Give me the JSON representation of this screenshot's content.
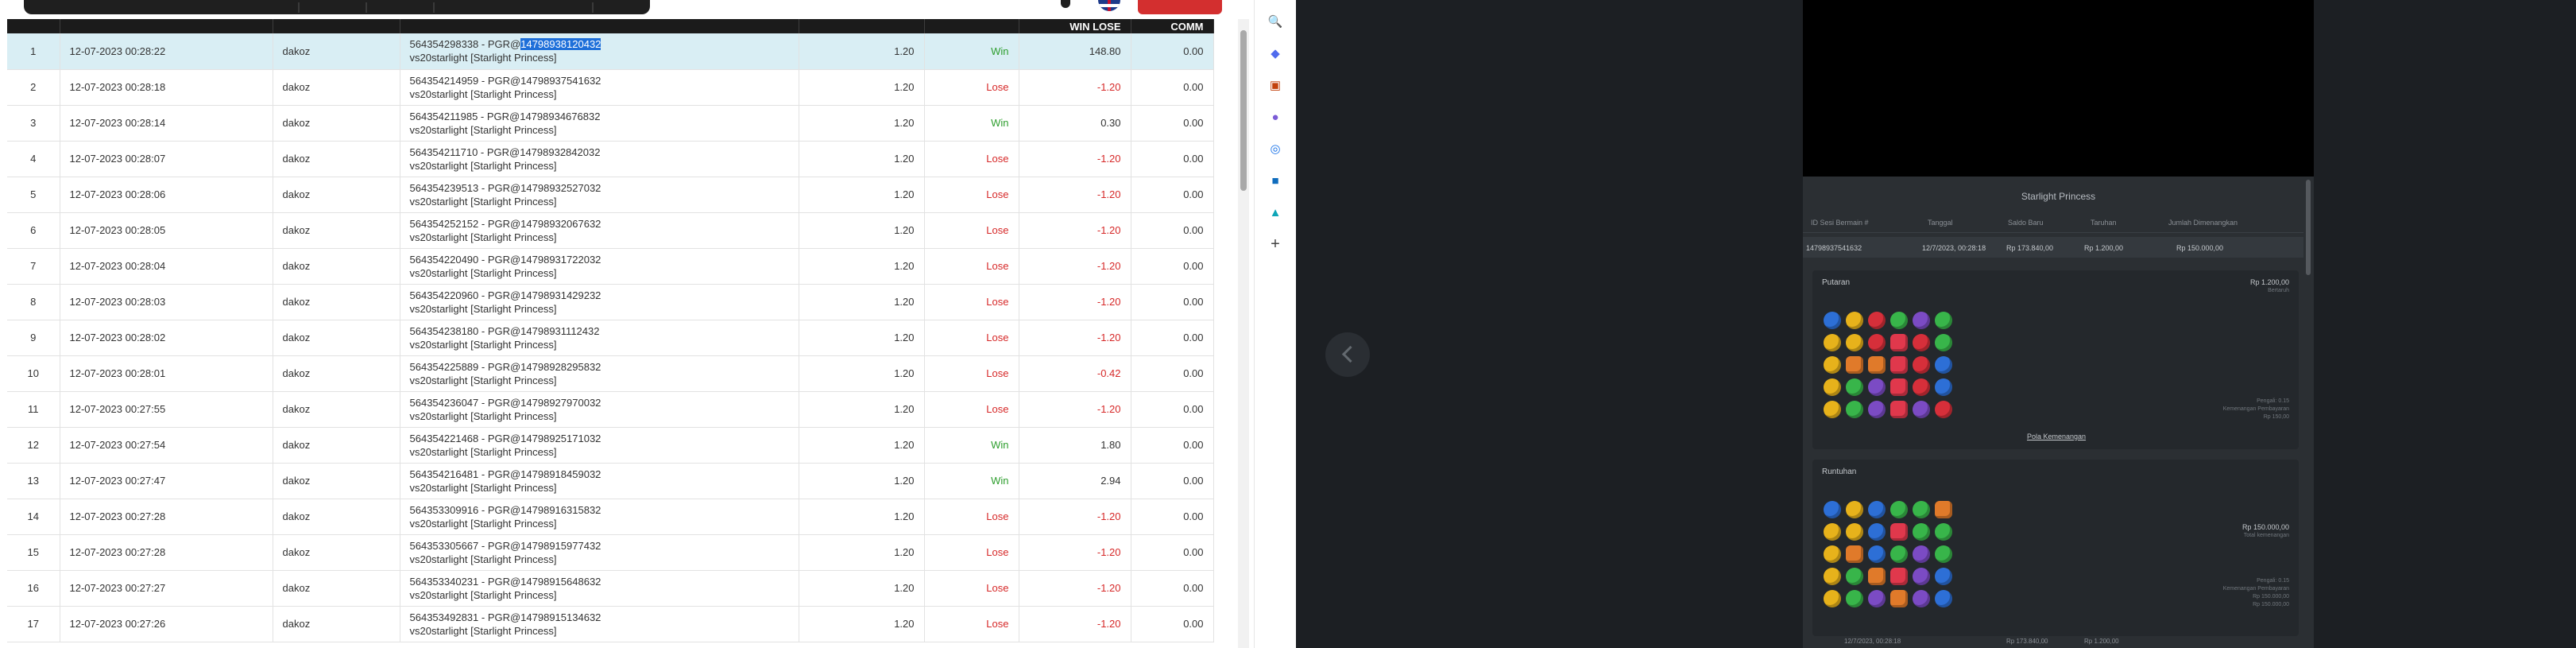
{
  "table": {
    "headers": [
      "",
      "",
      "",
      "",
      "",
      "",
      "WIN LOSE",
      "COMM"
    ],
    "rows": [
      {
        "no": "1",
        "date": "12-07-2023 00:28:22",
        "user": "dakoz",
        "id_prefix": "564354298338 - PGR@",
        "id_highlight": "14798938120432",
        "game": "vs20starlight [Starlight Princess]",
        "bet": "1.20",
        "status": "Win",
        "winlose": "148.80",
        "comm": "0.00"
      },
      {
        "no": "2",
        "date": "12-07-2023 00:28:18",
        "user": "dakoz",
        "id_prefix": "564354214959 - PGR@14798937541632",
        "id_highlight": "",
        "game": "vs20starlight [Starlight Princess]",
        "bet": "1.20",
        "status": "Lose",
        "winlose": "-1.20",
        "comm": "0.00"
      },
      {
        "no": "3",
        "date": "12-07-2023 00:28:14",
        "user": "dakoz",
        "id_prefix": "564354211985 - PGR@14798934676832",
        "id_highlight": "",
        "game": "vs20starlight [Starlight Princess]",
        "bet": "1.20",
        "status": "Win",
        "winlose": "0.30",
        "comm": "0.00"
      },
      {
        "no": "4",
        "date": "12-07-2023 00:28:07",
        "user": "dakoz",
        "id_prefix": "564354211710 - PGR@14798932842032",
        "id_highlight": "",
        "game": "vs20starlight [Starlight Princess]",
        "bet": "1.20",
        "status": "Lose",
        "winlose": "-1.20",
        "comm": "0.00"
      },
      {
        "no": "5",
        "date": "12-07-2023 00:28:06",
        "user": "dakoz",
        "id_prefix": "564354239513 - PGR@14798932527032",
        "id_highlight": "",
        "game": "vs20starlight [Starlight Princess]",
        "bet": "1.20",
        "status": "Lose",
        "winlose": "-1.20",
        "comm": "0.00"
      },
      {
        "no": "6",
        "date": "12-07-2023 00:28:05",
        "user": "dakoz",
        "id_prefix": "564354252152 - PGR@14798932067632",
        "id_highlight": "",
        "game": "vs20starlight [Starlight Princess]",
        "bet": "1.20",
        "status": "Lose",
        "winlose": "-1.20",
        "comm": "0.00"
      },
      {
        "no": "7",
        "date": "12-07-2023 00:28:04",
        "user": "dakoz",
        "id_prefix": "564354220490 - PGR@14798931722032",
        "id_highlight": "",
        "game": "vs20starlight [Starlight Princess]",
        "bet": "1.20",
        "status": "Lose",
        "winlose": "-1.20",
        "comm": "0.00"
      },
      {
        "no": "8",
        "date": "12-07-2023 00:28:03",
        "user": "dakoz",
        "id_prefix": "564354220960 - PGR@14798931429232",
        "id_highlight": "",
        "game": "vs20starlight [Starlight Princess]",
        "bet": "1.20",
        "status": "Lose",
        "winlose": "-1.20",
        "comm": "0.00"
      },
      {
        "no": "9",
        "date": "12-07-2023 00:28:02",
        "user": "dakoz",
        "id_prefix": "564354238180 - PGR@14798931112432",
        "id_highlight": "",
        "game": "vs20starlight [Starlight Princess]",
        "bet": "1.20",
        "status": "Lose",
        "winlose": "-1.20",
        "comm": "0.00"
      },
      {
        "no": "10",
        "date": "12-07-2023 00:28:01",
        "user": "dakoz",
        "id_prefix": "564354225889 - PGR@14798928295832",
        "id_highlight": "",
        "game": "vs20starlight [Starlight Princess]",
        "bet": "1.20",
        "status": "Lose",
        "winlose": "-0.42",
        "comm": "0.00"
      },
      {
        "no": "11",
        "date": "12-07-2023 00:27:55",
        "user": "dakoz",
        "id_prefix": "564354236047 - PGR@14798927970032",
        "id_highlight": "",
        "game": "vs20starlight [Starlight Princess]",
        "bet": "1.20",
        "status": "Lose",
        "winlose": "-1.20",
        "comm": "0.00"
      },
      {
        "no": "12",
        "date": "12-07-2023 00:27:54",
        "user": "dakoz",
        "id_prefix": "564354221468 - PGR@14798925171032",
        "id_highlight": "",
        "game": "vs20starlight [Starlight Princess]",
        "bet": "1.20",
        "status": "Win",
        "winlose": "1.80",
        "comm": "0.00"
      },
      {
        "no": "13",
        "date": "12-07-2023 00:27:47",
        "user": "dakoz",
        "id_prefix": "564354216481 - PGR@14798918459032",
        "id_highlight": "",
        "game": "vs20starlight [Starlight Princess]",
        "bet": "1.20",
        "status": "Win",
        "winlose": "2.94",
        "comm": "0.00"
      },
      {
        "no": "14",
        "date": "12-07-2023 00:27:28",
        "user": "dakoz",
        "id_prefix": "564353309916 - PGR@14798916315832",
        "id_highlight": "",
        "game": "vs20starlight [Starlight Princess]",
        "bet": "1.20",
        "status": "Lose",
        "winlose": "-1.20",
        "comm": "0.00"
      },
      {
        "no": "15",
        "date": "12-07-2023 00:27:28",
        "user": "dakoz",
        "id_prefix": "564353305667 - PGR@14798915977432",
        "id_highlight": "",
        "game": "vs20starlight [Starlight Princess]",
        "bet": "1.20",
        "status": "Lose",
        "winlose": "-1.20",
        "comm": "0.00"
      },
      {
        "no": "16",
        "date": "12-07-2023 00:27:27",
        "user": "dakoz",
        "id_prefix": "564353340231 - PGR@14798915648632",
        "id_highlight": "",
        "game": "vs20starlight [Starlight Princess]",
        "bet": "1.20",
        "status": "Lose",
        "winlose": "-1.20",
        "comm": "0.00"
      },
      {
        "no": "17",
        "date": "12-07-2023 00:27:26",
        "user": "dakoz",
        "id_prefix": "564353492831 - PGR@14798915134632",
        "id_highlight": "",
        "game": "vs20starlight [Starlight Princess]",
        "bet": "1.20",
        "status": "Lose",
        "winlose": "-1.20",
        "comm": "0.00"
      }
    ]
  },
  "sidebar": {
    "icons": [
      "search-icon",
      "tag-icon",
      "briefcase-icon",
      "people-icon",
      "office-icon",
      "outlook-icon",
      "shopping-cart-icon",
      "add-icon"
    ],
    "colors": [
      "#1a73e8",
      "#4f6bed",
      "#c2410c",
      "#7b5cd6",
      "#1a73e8",
      "#0f6cbd",
      "#0ea5b7",
      "#444444"
    ]
  },
  "viewer": {
    "title": "Starlight Princess",
    "headers": [
      "ID Sesi Bermain #",
      "Tanggal",
      "Saldo Baru",
      "Taruhan",
      "Jumlah Dimenangkan"
    ],
    "values": [
      "14798937541632",
      "12/7/2023, 00:28:18",
      "Rp 173.840,00",
      "Rp 1.200,00",
      "Rp 150.000,00"
    ],
    "spin": {
      "label": "Putaran",
      "amount": "Rp 1.200,00",
      "sub": "Bertaruh",
      "info": [
        "Pengali: 0.15",
        "Kemenangan Pembayaran",
        "Rp 150,00"
      ],
      "link": "Pola Kemenangan"
    },
    "tumble": {
      "label": "Runtuhan",
      "amount": "Rp 150.000,00",
      "sub": "Total kemenangan",
      "info": [
        "Pengali: 0.15",
        "Kemenangan Pembayaran",
        "Rp 150.000,00",
        "Rp 150.000,00"
      ]
    },
    "footer": [
      "12/7/2023, 00:28:18",
      "Rp 173.840,00",
      "Rp 1.200,00"
    ]
  },
  "gems": {
    "grid1": [
      [
        "blue",
        "gold",
        "red",
        "green",
        "purple",
        "green"
      ],
      [
        "gold",
        "gold",
        "red",
        "heart",
        "red",
        "green"
      ],
      [
        "gold",
        "orange",
        "orange",
        "heart",
        "red",
        "blue"
      ],
      [
        "gold",
        "green",
        "purple",
        "heart",
        "red",
        "blue"
      ],
      [
        "gold",
        "green",
        "purple",
        "heart",
        "purple",
        "red"
      ]
    ],
    "grid2": [
      [
        "blue",
        "gold",
        "blue",
        "green",
        "green",
        "orange"
      ],
      [
        "gold",
        "gold",
        "blue",
        "heart",
        "green",
        "green"
      ],
      [
        "gold",
        "orange",
        "blue",
        "green",
        "purple",
        "green"
      ],
      [
        "gold",
        "green",
        "orange",
        "heart",
        "purple",
        "blue"
      ],
      [
        "gold",
        "green",
        "purple",
        "orange",
        "purple",
        "blue"
      ]
    ],
    "palette": {
      "blue": "#2d6fd6",
      "gold": "#e7b21b",
      "red": "#d62f3a",
      "green": "#38b54a",
      "purple": "#7b4bc4",
      "heart": "#e0384c",
      "orange": "#e07a2a"
    }
  }
}
